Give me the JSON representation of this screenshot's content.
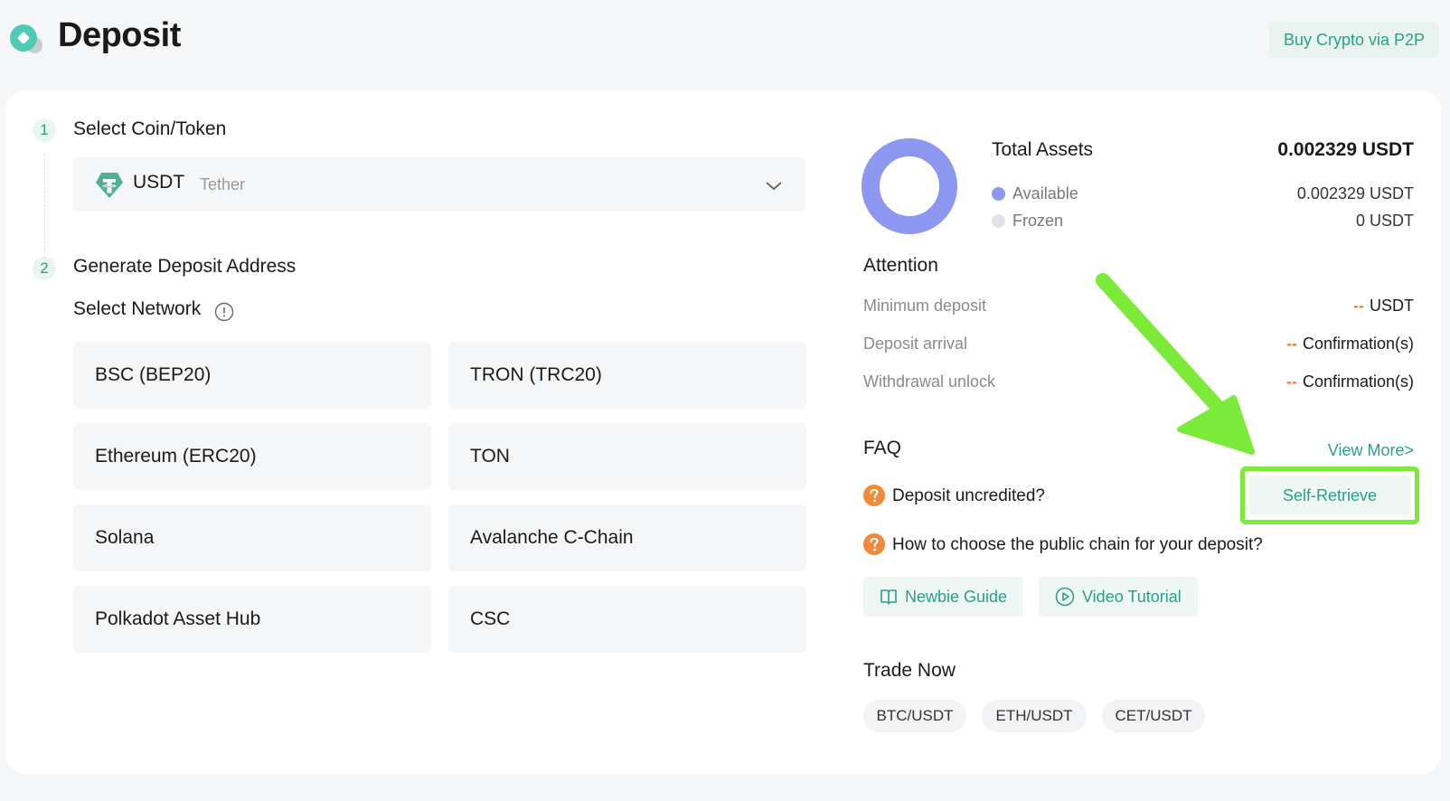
{
  "header": {
    "title": "Deposit",
    "p2p_button": "Buy Crypto via P2P"
  },
  "steps": [
    {
      "number": "1",
      "title": "Select Coin/Token"
    },
    {
      "number": "2",
      "title": "Generate Deposit Address"
    }
  ],
  "coin": {
    "symbol": "USDT",
    "name": "Tether",
    "icon": "tether-icon"
  },
  "network": {
    "label": "Select Network",
    "options": [
      "BSC (BEP20)",
      "TRON (TRC20)",
      "Ethereum (ERC20)",
      "TON",
      "Solana",
      "Avalanche C-Chain",
      "Polkadot Asset Hub",
      "CSC"
    ]
  },
  "assets": {
    "title": "Total Assets",
    "total": "0.002329 USDT",
    "available_label": "Available",
    "available_value": "0.002329 USDT",
    "frozen_label": "Frozen",
    "frozen_value": "0 USDT",
    "available_fraction": 1.0,
    "colors": {
      "available": "#8c98f0",
      "frozen": "#dfe3e8"
    }
  },
  "attention": {
    "title": "Attention",
    "rows": [
      {
        "label": "Minimum deposit",
        "dash": "--",
        "value": "USDT"
      },
      {
        "label": "Deposit arrival",
        "dash": "--",
        "value": "Confirmation(s)"
      },
      {
        "label": "Withdrawal unlock",
        "dash": "--",
        "value": "Confirmation(s)"
      }
    ]
  },
  "faq": {
    "title": "FAQ",
    "view_more": "View More>",
    "questions": [
      "Deposit uncredited?",
      "How to choose the public chain for your deposit?"
    ],
    "self_retrieve": "Self-Retrieve",
    "newbie_guide": "Newbie Guide",
    "video_tutorial": "Video Tutorial"
  },
  "trade": {
    "title": "Trade Now",
    "pairs": [
      "BTC/USDT",
      "ETH/USDT",
      "CET/USDT"
    ]
  },
  "colors": {
    "accent": "#2aa088",
    "highlight": "#7bea38",
    "warning": "#f07e2b"
  }
}
